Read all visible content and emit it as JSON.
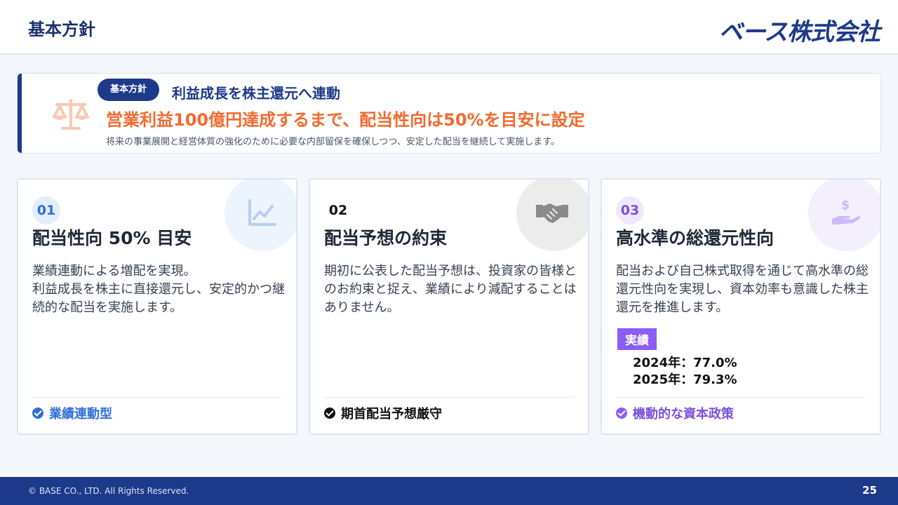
{
  "header": {
    "title": "基本方針",
    "logo": "ベース株式会社"
  },
  "banner": {
    "badge": "基本方針",
    "heading": "利益成長を株主還元へ連動",
    "main": "営業利益100億円達成するまで、配当性向は50%を目安に設定",
    "sub": "将来の事業展開と経営体質の強化のために必要な内部留保を確保しつつ、安定した配当を継続して実施します。",
    "icon": "scales-icon"
  },
  "cards": [
    {
      "number": "01",
      "title": "配当性向 50% 目安",
      "body": [
        "業績連動による増配を実現。",
        "利益成長を株主に直接還元し、安定的かつ継続的な配当を実施します。"
      ],
      "footer": "業績連動型",
      "icon": "chart-line-icon",
      "color": "#2f6fd8"
    },
    {
      "number": "02",
      "title": "配当予想の約束",
      "body": [
        "期初に公表した配当予想は、投資家の皆様とのお約束と捉え、業績により減配することはありません。"
      ],
      "footer": "期首配当予想厳守",
      "icon": "handshake-icon",
      "color": "#111111"
    },
    {
      "number": "03",
      "title": "高水準の総還元性向",
      "body": [
        "配当および自己株式取得を通じて高水準の総還元性向を実現し、資本効率も意識した株主還元を推進します。"
      ],
      "result_label": "実績",
      "results": [
        "2024年：77.0%",
        "2025年：79.3%"
      ],
      "footer": "機動的な資本政策",
      "icon": "hand-dollar-icon",
      "color": "#7c4fdc"
    }
  ],
  "footer": {
    "copyright": "© BASE CO., LTD. All Rights Reserved.",
    "page": "25"
  }
}
